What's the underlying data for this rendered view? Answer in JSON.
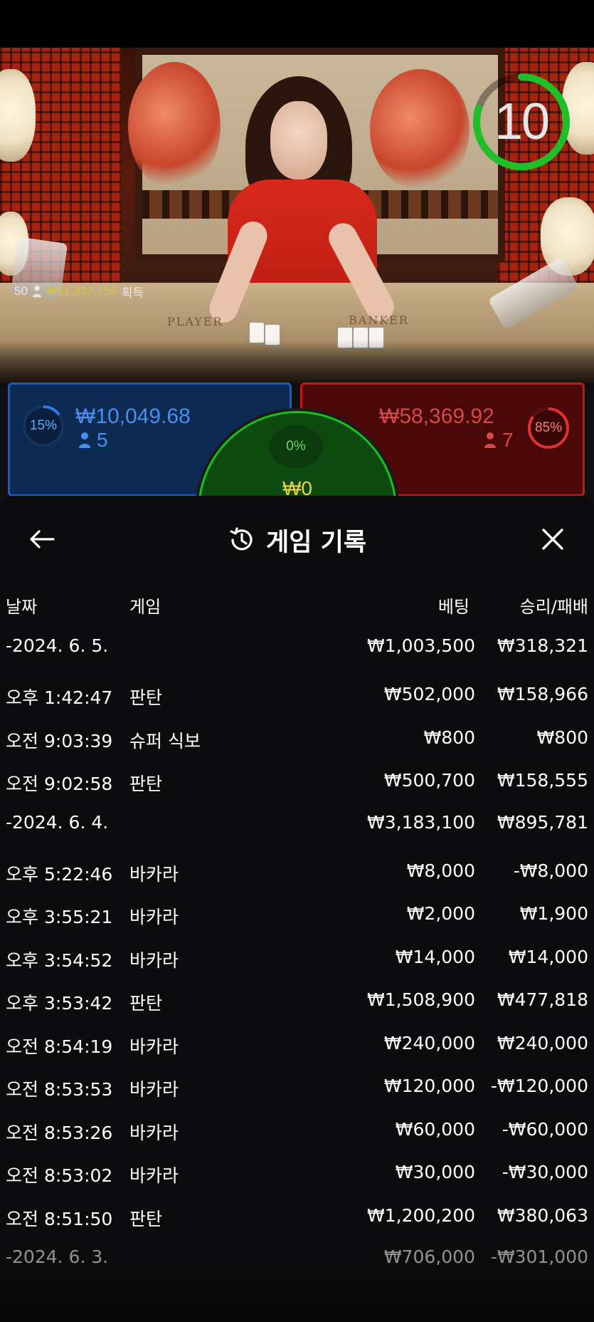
{
  "timer": {
    "value": "10",
    "progress": 0.8
  },
  "stream_overlay": {
    "players": "50",
    "amount": "₩11,337,756",
    "suffix": "획득"
  },
  "table_print": {
    "left": "PLAYER",
    "right": "BANKER"
  },
  "betting": {
    "player": {
      "percent": "15%",
      "percent_value": 0.15,
      "amount": "₩10,049.68",
      "count": "5"
    },
    "tie": {
      "percent": "0%",
      "amount": "₩0"
    },
    "banker": {
      "percent": "85%",
      "percent_value": 0.85,
      "amount": "₩58,369.92",
      "count": "7"
    }
  },
  "colors": {
    "player_blue": "#1a5cc4",
    "banker_red": "#c41818",
    "tie_green": "#18c21e",
    "timer_green": "#1fbf2a"
  },
  "modal": {
    "title": "게임 기록",
    "icons": {
      "back": "arrow-left-icon",
      "history": "history-icon",
      "close": "close-icon"
    },
    "columns": {
      "date": "날짜",
      "game": "게임",
      "bet": "베팅",
      "result": "승리/패배"
    },
    "rows": [
      {
        "type": "date",
        "time": "-2024. 6. 5.",
        "game": "",
        "bet": "₩1,003,500",
        "result": "₩318,321"
      },
      {
        "type": "item",
        "time": "오후 1:42:47",
        "game": "판탄",
        "bet": "₩502,000",
        "result": "₩158,966"
      },
      {
        "type": "item",
        "time": "오전 9:03:39",
        "game": "슈퍼 식보",
        "bet": "₩800",
        "result": "₩800"
      },
      {
        "type": "item",
        "time": "오전 9:02:58",
        "game": "판탄",
        "bet": "₩500,700",
        "result": "₩158,555"
      },
      {
        "type": "date",
        "time": "-2024. 6. 4.",
        "game": "",
        "bet": "₩3,183,100",
        "result": "₩895,781"
      },
      {
        "type": "item",
        "time": "오후 5:22:46",
        "game": "바카라",
        "bet": "₩8,000",
        "result": "-₩8,000"
      },
      {
        "type": "item",
        "time": "오후 3:55:21",
        "game": "바카라",
        "bet": "₩2,000",
        "result": "₩1,900"
      },
      {
        "type": "item",
        "time": "오후 3:54:52",
        "game": "바카라",
        "bet": "₩14,000",
        "result": "₩14,000"
      },
      {
        "type": "item",
        "time": "오후 3:53:42",
        "game": "판탄",
        "bet": "₩1,508,900",
        "result": "₩477,818"
      },
      {
        "type": "item",
        "time": "오전 8:54:19",
        "game": "바카라",
        "bet": "₩240,000",
        "result": "₩240,000"
      },
      {
        "type": "item",
        "time": "오전 8:53:53",
        "game": "바카라",
        "bet": "₩120,000",
        "result": "-₩120,000"
      },
      {
        "type": "item",
        "time": "오전 8:53:26",
        "game": "바카라",
        "bet": "₩60,000",
        "result": "-₩60,000"
      },
      {
        "type": "item",
        "time": "오전 8:53:02",
        "game": "바카라",
        "bet": "₩30,000",
        "result": "-₩30,000"
      },
      {
        "type": "item",
        "time": "오전 8:51:50",
        "game": "판탄",
        "bet": "₩1,200,200",
        "result": "₩380,063"
      },
      {
        "type": "date",
        "time": "-2024. 6. 3.",
        "game": "",
        "bet": "₩706,000",
        "result": "-₩301,000"
      }
    ]
  }
}
